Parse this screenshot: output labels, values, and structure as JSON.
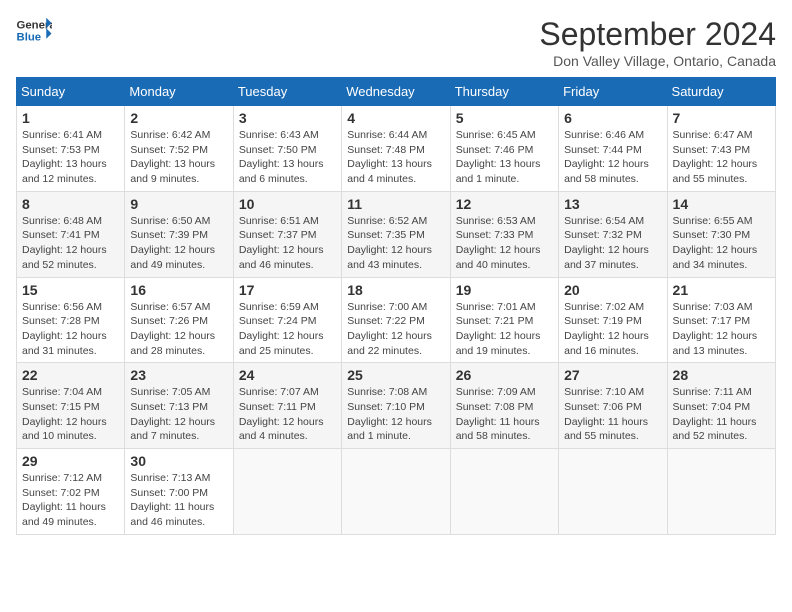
{
  "logo": {
    "line1": "General",
    "line2": "Blue"
  },
  "title": "September 2024",
  "location": "Don Valley Village, Ontario, Canada",
  "headers": [
    "Sunday",
    "Monday",
    "Tuesday",
    "Wednesday",
    "Thursday",
    "Friday",
    "Saturday"
  ],
  "weeks": [
    [
      {
        "day": "1",
        "detail": "Sunrise: 6:41 AM\nSunset: 7:53 PM\nDaylight: 13 hours\nand 12 minutes."
      },
      {
        "day": "2",
        "detail": "Sunrise: 6:42 AM\nSunset: 7:52 PM\nDaylight: 13 hours\nand 9 minutes."
      },
      {
        "day": "3",
        "detail": "Sunrise: 6:43 AM\nSunset: 7:50 PM\nDaylight: 13 hours\nand 6 minutes."
      },
      {
        "day": "4",
        "detail": "Sunrise: 6:44 AM\nSunset: 7:48 PM\nDaylight: 13 hours\nand 4 minutes."
      },
      {
        "day": "5",
        "detail": "Sunrise: 6:45 AM\nSunset: 7:46 PM\nDaylight: 13 hours\nand 1 minute."
      },
      {
        "day": "6",
        "detail": "Sunrise: 6:46 AM\nSunset: 7:44 PM\nDaylight: 12 hours\nand 58 minutes."
      },
      {
        "day": "7",
        "detail": "Sunrise: 6:47 AM\nSunset: 7:43 PM\nDaylight: 12 hours\nand 55 minutes."
      }
    ],
    [
      {
        "day": "8",
        "detail": "Sunrise: 6:48 AM\nSunset: 7:41 PM\nDaylight: 12 hours\nand 52 minutes."
      },
      {
        "day": "9",
        "detail": "Sunrise: 6:50 AM\nSunset: 7:39 PM\nDaylight: 12 hours\nand 49 minutes."
      },
      {
        "day": "10",
        "detail": "Sunrise: 6:51 AM\nSunset: 7:37 PM\nDaylight: 12 hours\nand 46 minutes."
      },
      {
        "day": "11",
        "detail": "Sunrise: 6:52 AM\nSunset: 7:35 PM\nDaylight: 12 hours\nand 43 minutes."
      },
      {
        "day": "12",
        "detail": "Sunrise: 6:53 AM\nSunset: 7:33 PM\nDaylight: 12 hours\nand 40 minutes."
      },
      {
        "day": "13",
        "detail": "Sunrise: 6:54 AM\nSunset: 7:32 PM\nDaylight: 12 hours\nand 37 minutes."
      },
      {
        "day": "14",
        "detail": "Sunrise: 6:55 AM\nSunset: 7:30 PM\nDaylight: 12 hours\nand 34 minutes."
      }
    ],
    [
      {
        "day": "15",
        "detail": "Sunrise: 6:56 AM\nSunset: 7:28 PM\nDaylight: 12 hours\nand 31 minutes."
      },
      {
        "day": "16",
        "detail": "Sunrise: 6:57 AM\nSunset: 7:26 PM\nDaylight: 12 hours\nand 28 minutes."
      },
      {
        "day": "17",
        "detail": "Sunrise: 6:59 AM\nSunset: 7:24 PM\nDaylight: 12 hours\nand 25 minutes."
      },
      {
        "day": "18",
        "detail": "Sunrise: 7:00 AM\nSunset: 7:22 PM\nDaylight: 12 hours\nand 22 minutes."
      },
      {
        "day": "19",
        "detail": "Sunrise: 7:01 AM\nSunset: 7:21 PM\nDaylight: 12 hours\nand 19 minutes."
      },
      {
        "day": "20",
        "detail": "Sunrise: 7:02 AM\nSunset: 7:19 PM\nDaylight: 12 hours\nand 16 minutes."
      },
      {
        "day": "21",
        "detail": "Sunrise: 7:03 AM\nSunset: 7:17 PM\nDaylight: 12 hours\nand 13 minutes."
      }
    ],
    [
      {
        "day": "22",
        "detail": "Sunrise: 7:04 AM\nSunset: 7:15 PM\nDaylight: 12 hours\nand 10 minutes."
      },
      {
        "day": "23",
        "detail": "Sunrise: 7:05 AM\nSunset: 7:13 PM\nDaylight: 12 hours\nand 7 minutes."
      },
      {
        "day": "24",
        "detail": "Sunrise: 7:07 AM\nSunset: 7:11 PM\nDaylight: 12 hours\nand 4 minutes."
      },
      {
        "day": "25",
        "detail": "Sunrise: 7:08 AM\nSunset: 7:10 PM\nDaylight: 12 hours\nand 1 minute."
      },
      {
        "day": "26",
        "detail": "Sunrise: 7:09 AM\nSunset: 7:08 PM\nDaylight: 11 hours\nand 58 minutes."
      },
      {
        "day": "27",
        "detail": "Sunrise: 7:10 AM\nSunset: 7:06 PM\nDaylight: 11 hours\nand 55 minutes."
      },
      {
        "day": "28",
        "detail": "Sunrise: 7:11 AM\nSunset: 7:04 PM\nDaylight: 11 hours\nand 52 minutes."
      }
    ],
    [
      {
        "day": "29",
        "detail": "Sunrise: 7:12 AM\nSunset: 7:02 PM\nDaylight: 11 hours\nand 49 minutes."
      },
      {
        "day": "30",
        "detail": "Sunrise: 7:13 AM\nSunset: 7:00 PM\nDaylight: 11 hours\nand 46 minutes."
      },
      {
        "day": "",
        "detail": ""
      },
      {
        "day": "",
        "detail": ""
      },
      {
        "day": "",
        "detail": ""
      },
      {
        "day": "",
        "detail": ""
      },
      {
        "day": "",
        "detail": ""
      }
    ]
  ]
}
